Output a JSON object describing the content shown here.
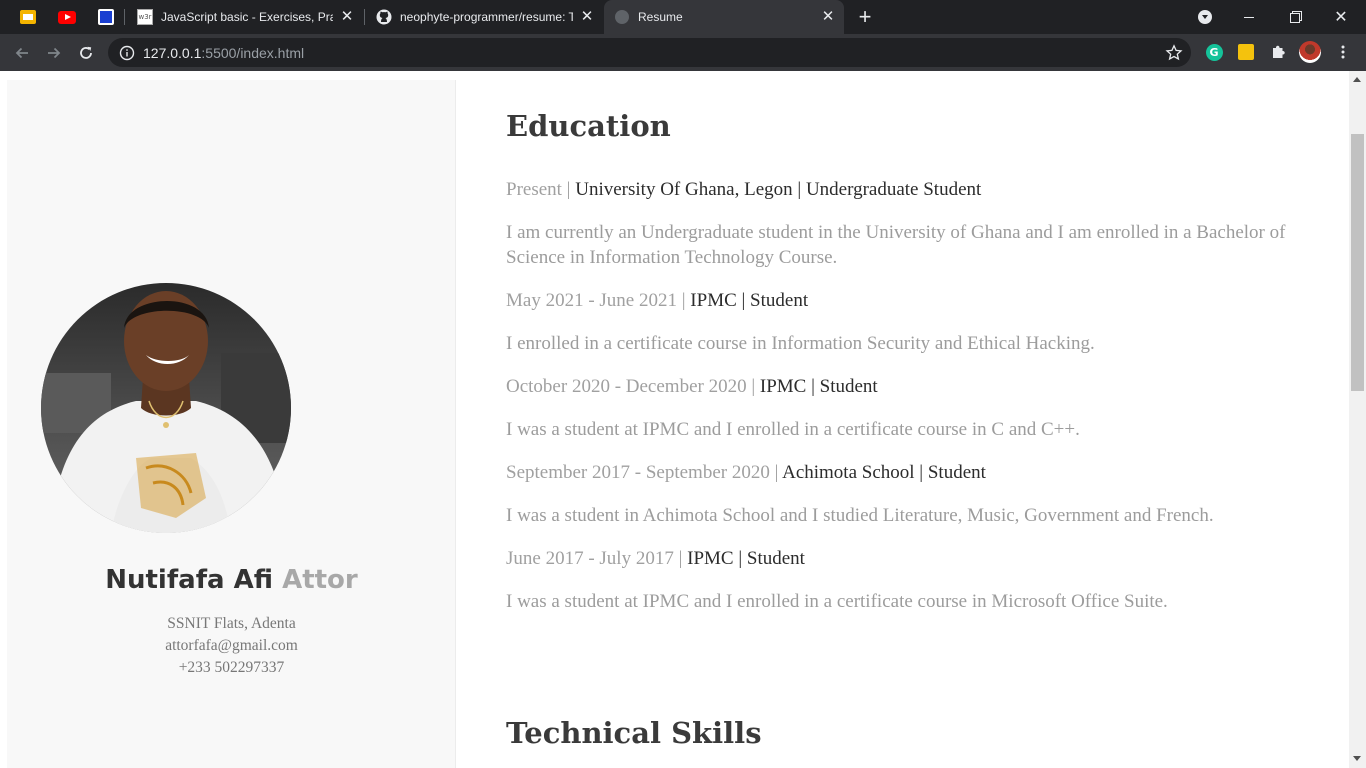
{
  "browser": {
    "tabs": [
      {
        "title": "JavaScript basic - Exercises, Practice",
        "favicon": "w3r-icon"
      },
      {
        "title": "neophyte-programmer/resume: The",
        "favicon": "github-icon"
      },
      {
        "title": "Resume",
        "favicon": "page-icon",
        "active": true
      }
    ],
    "url_host": "127.0.0.1",
    "url_rest": ":5500/index.html",
    "accent": "#35363a"
  },
  "profile": {
    "first_name": "Nutifafa Afi",
    "last_name": "Attor",
    "address": "SSNIT Flats, Adenta",
    "email": "attorfafa@gmail.com",
    "phone": "+233 502297337"
  },
  "education": {
    "heading": "Education",
    "entries": [
      {
        "date": "Present | ",
        "title": "University Of Ghana, Legon | Undergraduate Student",
        "description": "I am currently an Undergraduate student in the University of Ghana and I am enrolled in a Bachelor of Science in Information Technology Course."
      },
      {
        "date": "May 2021 - June 2021 | ",
        "title": "IPMC | Student",
        "description": "I enrolled in a certificate course in Information Security and Ethical Hacking."
      },
      {
        "date": "October 2020 - December 2020 | ",
        "title": "IPMC | Student",
        "description": "I was a student at IPMC and I enrolled in a certificate course in C and C++."
      },
      {
        "date": "September 2017 - September 2020 | ",
        "title": "Achimota School | Student",
        "description": "I was a student in Achimota School and I studied Literature, Music, Government and French."
      },
      {
        "date": "June 2017 - July 2017 | ",
        "title": "IPMC | Student",
        "description": "I was a student at IPMC and I enrolled in a certificate course in Microsoft Office Suite."
      }
    ]
  },
  "skills": {
    "heading": "Technical Skills"
  }
}
